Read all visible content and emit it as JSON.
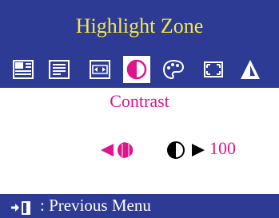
{
  "header": {
    "title": "Highlight Zone"
  },
  "toolbar": {
    "icons": [
      {
        "name": "zone-size-icon",
        "selected": false
      },
      {
        "name": "zone-position-icon",
        "selected": false
      },
      {
        "name": "zone-width-icon",
        "selected": false
      },
      {
        "name": "contrast-icon",
        "selected": true
      },
      {
        "name": "color-palette-icon",
        "selected": false
      },
      {
        "name": "sharpness-icon",
        "selected": false
      },
      {
        "name": "gamma-icon",
        "selected": false
      }
    ]
  },
  "panel": {
    "item_title": "Contrast",
    "value": "100"
  },
  "footer": {
    "text": ": Previous Menu"
  },
  "colors": {
    "background": "#2e3b95",
    "title_text": "#f2e64a",
    "accent": "#e0148c",
    "panel": "#ffffff"
  }
}
